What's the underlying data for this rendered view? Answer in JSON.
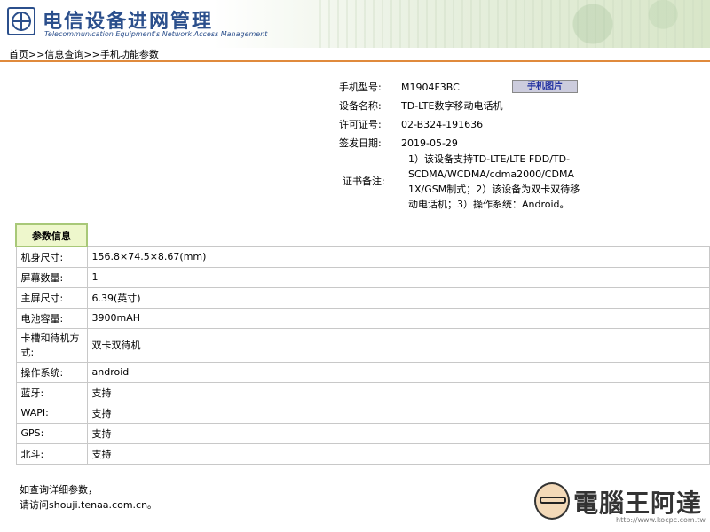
{
  "header": {
    "title_cn": "电信设备进网管理",
    "title_en": "Telecommunication Equipment's Network Access Management"
  },
  "breadcrumb": "首页>>信息查询>>手机功能参数",
  "info": {
    "model_label": "手机型号:",
    "model_value": "M1904F3BC",
    "photo_button": "手机图片",
    "device_label": "设备名称:",
    "device_value": "TD-LTE数字移动电话机",
    "license_label": "许可证号:",
    "license_value": "02-B324-191636",
    "date_label": "签发日期:",
    "date_value": "2019-05-29",
    "remark_label": "证书备注:",
    "remark_value": "1）该设备支持TD-LTE/LTE FDD/TD-SCDMA/WCDMA/cdma2000/CDMA 1X/GSM制式；2）该设备为双卡双待移动电话机；3）操作系统：Android。"
  },
  "params": {
    "header": "参数信息",
    "rows": [
      {
        "label": "机身尺寸:",
        "value": "156.8×74.5×8.67(mm)"
      },
      {
        "label": "屏幕数量:",
        "value": "1"
      },
      {
        "label": "主屏尺寸:",
        "value": "6.39(英寸)"
      },
      {
        "label": "电池容量:",
        "value": "3900mAH"
      },
      {
        "label": "卡槽和待机方式:",
        "value": "双卡双待机"
      },
      {
        "label": "操作系统:",
        "value": "android"
      },
      {
        "label": "蓝牙:",
        "value": "支持"
      },
      {
        "label": "WAPI:",
        "value": "支持"
      },
      {
        "label": "GPS:",
        "value": "支持"
      },
      {
        "label": "北斗:",
        "value": "支持"
      }
    ]
  },
  "footer": {
    "line1": "如查询详细参数，",
    "line2": "请访问shouji.tenaa.com.cn。"
  },
  "watermark": {
    "text": "電腦王阿達",
    "url": "http://www.kocpc.com.tw"
  }
}
